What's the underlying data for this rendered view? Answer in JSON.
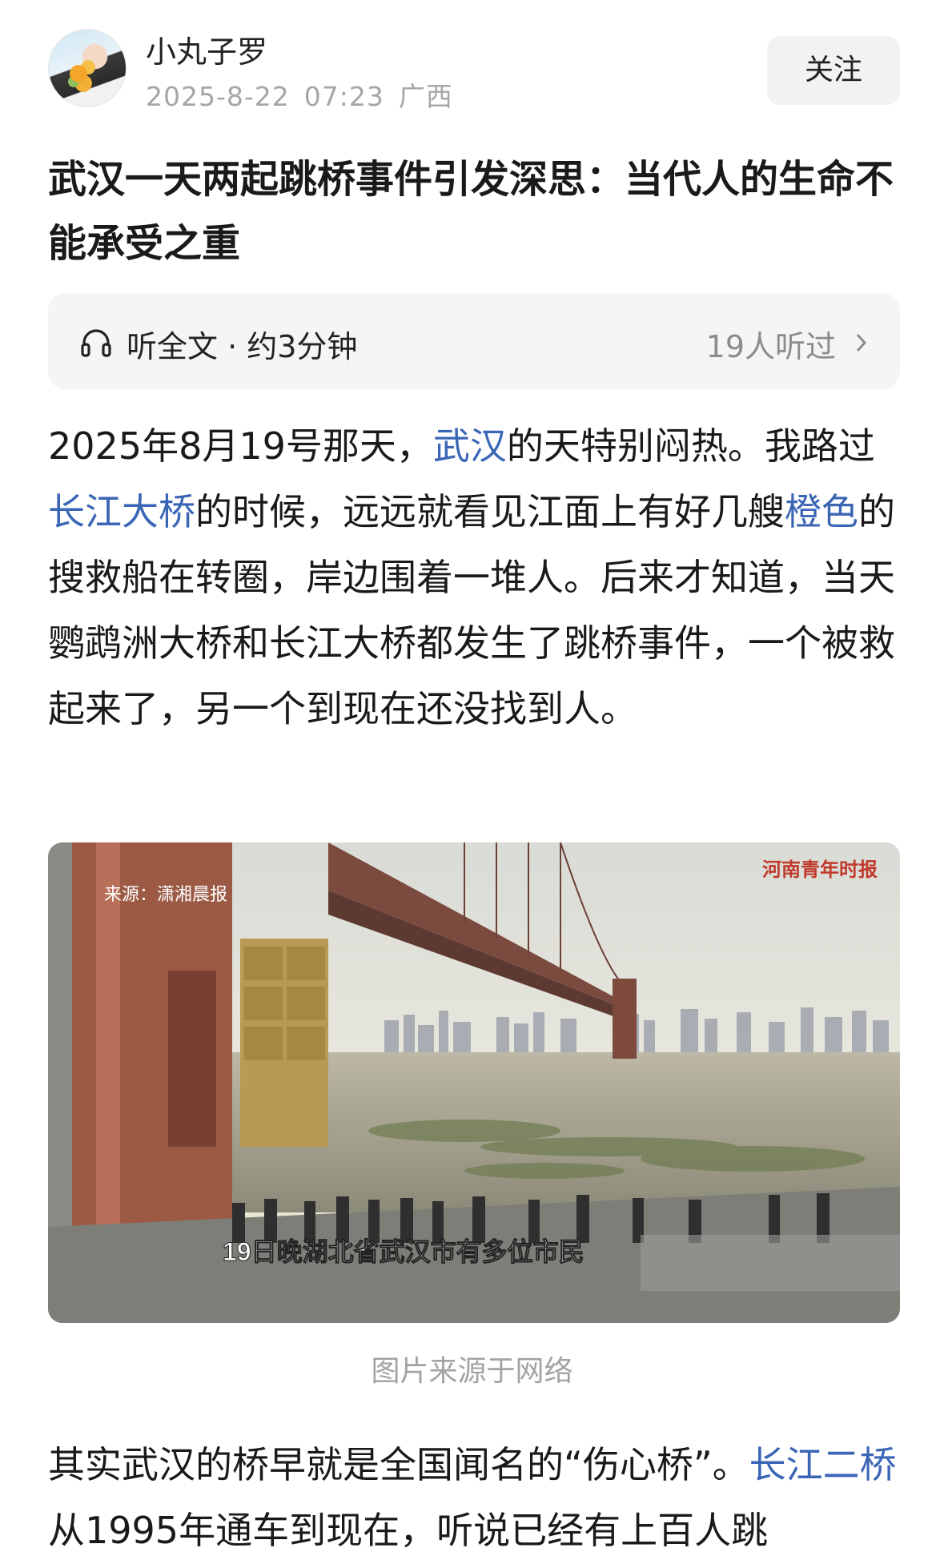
{
  "author": {
    "name": "小丸子罗",
    "date": "2025-8-22",
    "time": "07:23",
    "location": "广西",
    "follow_label": "关注"
  },
  "article": {
    "title": "武汉一天两起跳桥事件引发深思：当代人的生命不能承受之重",
    "listen": {
      "icon": "headphone-icon",
      "label": "听全文 · 约3分钟",
      "count": "19人听过",
      "chevron": "chevron-right-icon"
    },
    "paragraph1": {
      "t1": "2025年8月19号那天，",
      "link1": "武汉",
      "t2": "的天特别闷热。我路过",
      "link2": "长江大桥",
      "t3": "的时候，远远就看见江面上有好几艘",
      "link3": "橙色",
      "t4": "的搜救船在转圈，岸边围着一堆人。后来才知道，当天鹦鹉洲大桥和长江大桥都发生了跳桥事件，一个被救起来了，另一个到现在还没找到人。"
    },
    "image": {
      "source_label": "来源：潇湘晨报",
      "watermark": "河南青年时报",
      "subtitle": "19日晚湖北省武汉市有多位市民",
      "caption": "图片来源于网络"
    },
    "paragraph2": {
      "t1": "其实武汉的桥早就是全国闻名的“伤心桥”。",
      "link1": "长江二桥",
      "t2": "从1995年通车到现在，听说已经有上百人跳"
    }
  },
  "colors": {
    "link": "#3b66b6",
    "meta_gray": "#a6a6a6",
    "button_bg": "#f2f2f2",
    "listen_bg": "#f5f5f7"
  }
}
